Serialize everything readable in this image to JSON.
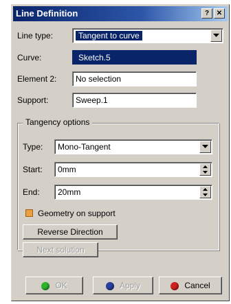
{
  "window": {
    "title": "Line Definition",
    "help_glyph": "?",
    "close_glyph": "✕"
  },
  "line_type": {
    "label": "Line type:",
    "value": "Tangent to curve"
  },
  "curve": {
    "label": "Curve:",
    "value": "Sketch.5"
  },
  "element2": {
    "label": "Element 2:",
    "value": "No selection"
  },
  "support": {
    "label": "Support:",
    "value": "Sweep.1"
  },
  "tangency": {
    "legend": "Tangency options",
    "type": {
      "label": "Type:",
      "value": "Mono-Tangent"
    },
    "start": {
      "label": "Start:",
      "value": "0mm"
    },
    "end": {
      "label": "End:",
      "value": "20mm"
    }
  },
  "geometry_on_support": {
    "label": "Geometry on support",
    "checked": true
  },
  "buttons": {
    "reverse": "Reverse Direction",
    "next": "Next solution",
    "ok": "OK",
    "apply": "Apply",
    "cancel": "Cancel"
  },
  "colors": {
    "ok_dot": "#2db52d",
    "apply_dot": "#2a3f9e",
    "cancel_dot": "#d02020",
    "title_bar": "#0a246a"
  }
}
